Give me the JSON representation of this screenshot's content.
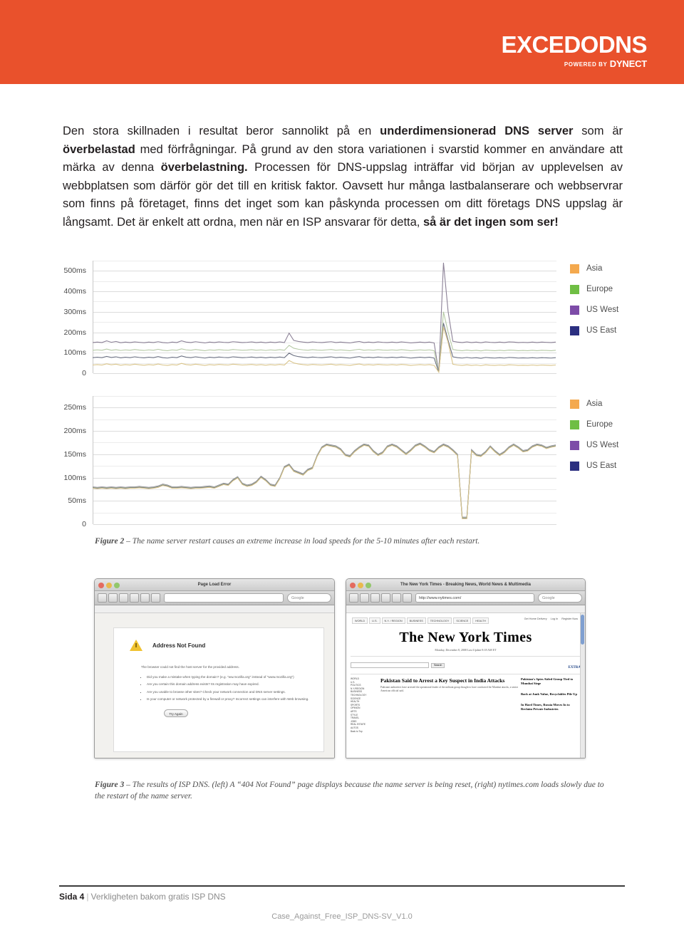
{
  "header": {
    "brand_main": "EXCEDODNS",
    "brand_powered": "POWERED BY",
    "brand_dynect": "DYNECT",
    "band_color": "#e9512c"
  },
  "body_copy": {
    "html": "Den stora skillnaden i resultat beror sannolikt på en <b>underdimensionerad DNS server</b> som är <b>överbelastad</b> med förfrågningar. På grund av den stora variationen i svarstid kommer en användare att märka av denna <b>överbelastning.</b> Processen för DNS-uppslag inträffar vid början av upplevelsen av webbplatsen som därför gör det till en kritisk faktor. Oavsett hur många lastbalanserare och webbservrar som finns på företaget, finns det inget som kan påskynda processen om ditt företags DNS uppslag är långsamt. Det är enkelt att ordna, men när en ISP ansvarar för detta, <b>så är det ingen som ser!</b>"
  },
  "legend_colors": {
    "asia": "#f4a94e",
    "europe": "#6fbe44",
    "us_west": "#7d4ca8",
    "us_east": "#2b2f80"
  },
  "series_line_colors": {
    "asia": "#d9c48a",
    "europe": "#b5c9a4",
    "us_west": "#8b8096",
    "us_east": "#6b7082"
  },
  "chart_data": [
    {
      "id": "chart-top",
      "type": "line",
      "title": "",
      "xlabel": "",
      "ylabel": "",
      "ylim": [
        0,
        550
      ],
      "yticks": [
        0,
        100,
        200,
        300,
        400,
        500
      ],
      "ytick_labels": [
        "0",
        "100ms",
        "200ms",
        "300ms",
        "400ms",
        "500ms"
      ],
      "minor_tick_step": 50,
      "grid": true,
      "legend_position": "right",
      "legend": [
        "Asia",
        "Europe",
        "US West",
        "US East"
      ],
      "series": [
        {
          "name": "US West",
          "values": [
            150,
            152,
            150,
            158,
            151,
            155,
            149,
            152,
            150,
            153,
            151,
            149,
            152,
            150,
            154,
            150,
            148,
            152,
            150,
            158,
            152,
            150,
            154,
            151,
            148,
            152,
            150,
            153,
            151,
            150,
            154,
            152,
            150,
            151,
            153,
            150,
            152,
            149,
            152,
            150,
            153,
            150,
            196,
            160,
            155,
            152,
            150,
            153,
            151,
            150,
            152,
            154,
            150,
            152,
            150,
            148,
            152,
            155,
            150,
            152,
            150,
            153,
            151,
            150,
            152,
            150,
            153,
            151,
            148,
            150,
            152,
            150,
            152,
            148,
            5,
            540,
            300,
            156,
            152,
            150,
            153,
            150,
            152,
            149,
            153,
            151,
            150,
            152,
            150,
            153,
            152,
            150,
            151,
            150,
            152,
            150,
            152,
            151,
            150,
            152
          ]
        },
        {
          "name": "Europe",
          "values": [
            112,
            114,
            112,
            118,
            112,
            115,
            111,
            114,
            112,
            116,
            113,
            111,
            114,
            112,
            117,
            112,
            110,
            114,
            112,
            119,
            114,
            112,
            116,
            113,
            110,
            114,
            112,
            115,
            113,
            112,
            116,
            114,
            112,
            113,
            115,
            112,
            114,
            111,
            114,
            112,
            115,
            112,
            136,
            122,
            117,
            114,
            112,
            115,
            113,
            112,
            114,
            116,
            112,
            114,
            112,
            110,
            114,
            117,
            112,
            114,
            112,
            115,
            113,
            112,
            114,
            112,
            115,
            113,
            110,
            112,
            114,
            112,
            114,
            110,
            5,
            300,
            200,
            116,
            112,
            110,
            113,
            110,
            112,
            109,
            113,
            111,
            110,
            112,
            110,
            113,
            112,
            110,
            111,
            110,
            112,
            110,
            112,
            111,
            110,
            112
          ]
        },
        {
          "name": "US East",
          "values": [
            76,
            78,
            76,
            82,
            77,
            80,
            75,
            78,
            76,
            80,
            77,
            75,
            78,
            76,
            81,
            76,
            74,
            78,
            76,
            84,
            78,
            76,
            80,
            77,
            74,
            78,
            76,
            79,
            77,
            76,
            80,
            78,
            76,
            77,
            79,
            76,
            78,
            75,
            78,
            76,
            79,
            76,
            98,
            86,
            81,
            78,
            76,
            79,
            77,
            76,
            78,
            80,
            76,
            78,
            76,
            74,
            78,
            81,
            76,
            78,
            76,
            79,
            77,
            76,
            78,
            76,
            79,
            77,
            74,
            76,
            78,
            76,
            78,
            74,
            5,
            245,
            160,
            80,
            76,
            74,
            77,
            74,
            76,
            73,
            77,
            75,
            74,
            76,
            74,
            77,
            76,
            74,
            75,
            74,
            76,
            74,
            76,
            75,
            74,
            76
          ]
        },
        {
          "name": "Asia",
          "values": [
            40,
            42,
            40,
            46,
            41,
            44,
            39,
            42,
            40,
            44,
            41,
            39,
            42,
            40,
            45,
            40,
            38,
            42,
            40,
            48,
            42,
            40,
            44,
            41,
            38,
            42,
            40,
            43,
            41,
            40,
            44,
            42,
            40,
            41,
            43,
            40,
            42,
            39,
            42,
            40,
            43,
            40,
            62,
            50,
            45,
            42,
            40,
            43,
            41,
            40,
            42,
            44,
            40,
            42,
            40,
            38,
            42,
            45,
            40,
            42,
            40,
            43,
            41,
            40,
            42,
            40,
            43,
            41,
            38,
            40,
            42,
            40,
            42,
            38,
            5,
            225,
            150,
            44,
            40,
            38,
            41,
            38,
            40,
            37,
            41,
            39,
            38,
            40,
            38,
            41,
            40,
            38,
            39,
            38,
            40,
            38,
            40,
            39,
            38,
            40
          ]
        }
      ]
    },
    {
      "id": "chart-bottom",
      "type": "line",
      "title": "",
      "xlabel": "",
      "ylabel": "",
      "ylim": [
        0,
        275
      ],
      "yticks": [
        0,
        50,
        100,
        150,
        200,
        250
      ],
      "ytick_labels": [
        "0",
        "50ms",
        "100ms",
        "150ms",
        "200ms",
        "250ms"
      ],
      "minor_tick_step": 25,
      "grid": true,
      "legend_position": "right",
      "legend": [
        "Asia",
        "Europe",
        "US West",
        "US East"
      ],
      "series": [
        {
          "name": "US West",
          "values": [
            80,
            79,
            80,
            79,
            80,
            79,
            80,
            79,
            80,
            80,
            81,
            80,
            79,
            80,
            82,
            86,
            84,
            80,
            80,
            81,
            80,
            79,
            80,
            80,
            81,
            82,
            80,
            84,
            88,
            86,
            96,
            102,
            88,
            84,
            86,
            92,
            103,
            96,
            86,
            84,
            100,
            124,
            129,
            116,
            112,
            108,
            118,
            122,
            148,
            166,
            172,
            170,
            168,
            162,
            150,
            147,
            158,
            166,
            172,
            170,
            158,
            150,
            155,
            168,
            172,
            168,
            160,
            152,
            160,
            170,
            174,
            168,
            160,
            156,
            166,
            172,
            168,
            160,
            150,
            15,
            15,
            160,
            150,
            148,
            156,
            168,
            158,
            150,
            156,
            166,
            172,
            166,
            158,
            160,
            168,
            172,
            170,
            165,
            168,
            170
          ]
        },
        {
          "name": "Europe",
          "values": [
            79,
            78,
            79,
            78,
            79,
            78,
            79,
            78,
            79,
            79,
            80,
            79,
            78,
            79,
            81,
            85,
            83,
            79,
            79,
            80,
            79,
            78,
            79,
            79,
            80,
            81,
            79,
            83,
            87,
            85,
            95,
            101,
            87,
            83,
            85,
            91,
            102,
            95,
            85,
            83,
            99,
            123,
            128,
            115,
            111,
            107,
            117,
            121,
            147,
            165,
            171,
            169,
            167,
            161,
            149,
            146,
            157,
            165,
            171,
            169,
            157,
            149,
            154,
            167,
            171,
            167,
            159,
            151,
            159,
            169,
            173,
            167,
            159,
            155,
            165,
            171,
            167,
            159,
            149,
            14,
            14,
            159,
            149,
            147,
            155,
            167,
            157,
            149,
            155,
            165,
            171,
            165,
            157,
            159,
            167,
            171,
            169,
            164,
            167,
            169
          ]
        },
        {
          "name": "US East",
          "values": [
            78,
            77,
            78,
            77,
            78,
            77,
            78,
            77,
            78,
            78,
            79,
            78,
            77,
            78,
            80,
            84,
            82,
            78,
            78,
            79,
            78,
            77,
            78,
            78,
            79,
            80,
            78,
            82,
            86,
            84,
            94,
            100,
            86,
            82,
            84,
            90,
            101,
            94,
            84,
            82,
            98,
            122,
            127,
            114,
            110,
            106,
            116,
            120,
            146,
            164,
            170,
            168,
            166,
            160,
            148,
            145,
            156,
            164,
            170,
            168,
            156,
            148,
            153,
            166,
            170,
            166,
            158,
            150,
            158,
            168,
            172,
            166,
            158,
            154,
            164,
            170,
            166,
            158,
            148,
            13,
            13,
            158,
            148,
            146,
            154,
            166,
            156,
            148,
            154,
            164,
            170,
            164,
            156,
            158,
            166,
            170,
            168,
            163,
            166,
            168
          ]
        },
        {
          "name": "Asia",
          "values": [
            77,
            76,
            77,
            76,
            77,
            76,
            77,
            76,
            77,
            77,
            78,
            77,
            76,
            77,
            79,
            83,
            81,
            77,
            77,
            78,
            77,
            76,
            77,
            77,
            78,
            79,
            77,
            81,
            85,
            83,
            93,
            99,
            85,
            81,
            83,
            89,
            100,
            93,
            83,
            81,
            97,
            121,
            126,
            113,
            109,
            105,
            115,
            119,
            145,
            163,
            169,
            167,
            165,
            159,
            147,
            144,
            155,
            163,
            169,
            167,
            155,
            147,
            152,
            165,
            169,
            165,
            157,
            149,
            157,
            167,
            171,
            165,
            157,
            153,
            163,
            169,
            165,
            157,
            147,
            12,
            12,
            157,
            147,
            145,
            153,
            165,
            155,
            147,
            153,
            163,
            169,
            163,
            155,
            157,
            165,
            169,
            167,
            162,
            165,
            167
          ]
        }
      ]
    }
  ],
  "captions": {
    "fig2_num": "Figure 2",
    "fig2_text": "–  The name server restart causes an extreme increase in load speeds for the 5-10 minutes after each restart.",
    "fig3_num": "Figure 3",
    "fig3_text": "–  The results of ISP DNS. (left) A “404 Not Found” page displays because the name server is being reset, (right) nytimes.com loads slowly due to the restart of the name server."
  },
  "screenshot_left": {
    "window_title": "Page Load Error",
    "url_value": "",
    "search_placeholder": "Google",
    "error_title": "Address Not Found",
    "error_intro": "The browser could not find the host server for the provided address.",
    "bullets": [
      "Did you make a mistake when typing the domain? (e.g. \"ww.mozilla.org\" instead of \"www.mozilla.org\")",
      "Are you certain this domain address exists? Its registration may have expired.",
      "Are you unable to browse other sites? Check your network connection and DNS server settings.",
      "Is your computer or network protected by a firewall or proxy? Incorrect settings can interfere with Web browsing."
    ],
    "button_label": "Try Again"
  },
  "screenshot_right": {
    "window_title": "The New York Times - Breaking News, World News & Multimedia",
    "url_value": "http://www.nytimes.com/",
    "search_placeholder": "Google",
    "nav_tabs": [
      "WORLD",
      "U.S.",
      "N.Y. / REGION",
      "BUSINESS",
      "TECHNOLOGY",
      "SCIENCE",
      "HEALTH"
    ],
    "right_links": [
      "Get Home Delivery",
      "Log In",
      "Register Now"
    ],
    "masthead": "The New York Times",
    "date_line": "Monday, December 8, 2008",
    "last_update": "Last Update  8:18 AM ET",
    "search_button": "Search",
    "extra_label": "EXTRA",
    "headline_main": "Pakistan Said to Arrest a Key Suspect in India Attacks",
    "headline_sub": "Pakistani authorities have arrested the operational leader of the militant group thought to have conducted the Mumbai attacks, a senior American official said.",
    "section_heads": [
      "Pakistan's Spies Aided Group Tied to Mumbai Siege",
      "Back at Junk Value, Recyclables Pile Up",
      "In Hard Times, Russia Moves In to Reclaim Private Industries"
    ],
    "sidebar_items": [
      "WORLD",
      "U.S.",
      "POLITICS",
      "N.Y./REGION",
      "BUSINESS",
      "TECHNOLOGY",
      "SCIENCE",
      "HEALTH",
      "SPORTS",
      "OPINION",
      "ARTS",
      "STYLE",
      "TRAVEL",
      "JOBS",
      "REAL ESTATE",
      "AUTOS",
      "Back to Top"
    ]
  },
  "footer": {
    "page_label": "Sida 4",
    "separator": "|",
    "doc_title": "Verkligheten bakom gratis ISP DNS",
    "doc_code": "Case_Against_Free_ISP_DNS-SV_V1.0"
  }
}
